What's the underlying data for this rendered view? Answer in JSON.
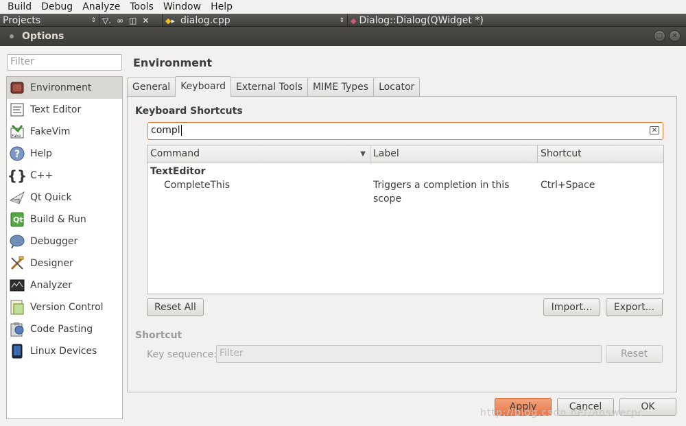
{
  "menubar": {
    "items": [
      "Build",
      "Debug",
      "Analyze",
      "Tools",
      "Window",
      "Help"
    ]
  },
  "creator_toolbar": {
    "projects_label": "Projects",
    "file_label": "dialog.cpp",
    "symbol_label": "Dialog::Dialog(QWidget *)"
  },
  "dialog": {
    "title": "Options"
  },
  "sidebar": {
    "filter_placeholder": "Filter",
    "items": [
      {
        "label": "Environment",
        "icon": "environment-icon"
      },
      {
        "label": "Text Editor",
        "icon": "text-editor-icon"
      },
      {
        "label": "FakeVim",
        "icon": "fakevim-icon"
      },
      {
        "label": "Help",
        "icon": "help-icon"
      },
      {
        "label": "C++",
        "icon": "cpp-braces-icon"
      },
      {
        "label": "Qt Quick",
        "icon": "qt-quick-icon"
      },
      {
        "label": "Build & Run",
        "icon": "build-run-icon"
      },
      {
        "label": "Debugger",
        "icon": "debugger-icon"
      },
      {
        "label": "Designer",
        "icon": "designer-icon"
      },
      {
        "label": "Analyzer",
        "icon": "analyzer-icon"
      },
      {
        "label": "Version Control",
        "icon": "version-control-icon"
      },
      {
        "label": "Code Pasting",
        "icon": "code-pasting-icon"
      },
      {
        "label": "Linux Devices",
        "icon": "linux-devices-icon"
      }
    ],
    "selected_index": 0
  },
  "page": {
    "title": "Environment",
    "tabs": [
      "General",
      "Keyboard",
      "External Tools",
      "MIME Types",
      "Locator"
    ],
    "active_tab": "Keyboard"
  },
  "keyboard": {
    "section_title": "Keyboard Shortcuts",
    "search_value": "compl",
    "columns": [
      "Command",
      "Label",
      "Shortcut"
    ],
    "rows": [
      {
        "command": "TextEditor",
        "label": "",
        "shortcut": "",
        "group": true
      },
      {
        "command": "CompleteThis",
        "label": "Triggers a completion in this scope",
        "shortcut": "Ctrl+Space",
        "group": false
      }
    ],
    "reset_all_label": "Reset All",
    "import_label": "Import...",
    "export_label": "Export..."
  },
  "shortcut": {
    "section_title": "Shortcut",
    "key_sequence_label": "Key sequence:",
    "key_sequence_placeholder": "Filter",
    "reset_label": "Reset"
  },
  "footer": {
    "apply_label": "Apply",
    "cancel_label": "Cancel",
    "ok_label": "OK"
  },
  "watermark": "http://blog.csdn.net/answerpc",
  "colors": {
    "accent": "#e8752a",
    "titlebar": "#3c3b37",
    "selection": "#d9d8d4"
  }
}
